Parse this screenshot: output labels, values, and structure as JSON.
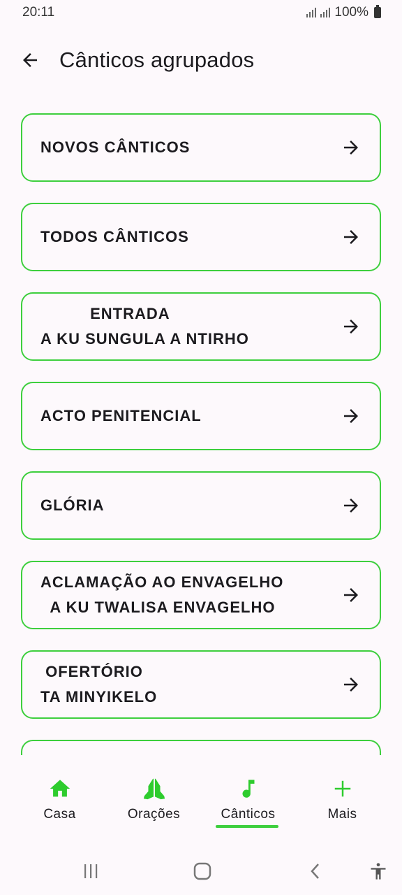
{
  "status_bar": {
    "time": "20:11",
    "battery": "100%"
  },
  "app_bar": {
    "title": "Cânticos agrupados"
  },
  "cards": [
    {
      "label": "NOVOS CÂNTICOS"
    },
    {
      "label": "TODOS CÂNTICOS"
    },
    {
      "label": "          ENTRADA\nA KU SUNGULA A NTIRHO"
    },
    {
      "label": "ACTO PENITENCIAL"
    },
    {
      "label": "GLÓRIA"
    },
    {
      "label": "ACLAMAÇÃO AO ENVAGELHO\n  A KU TWALISA ENVAGELHO"
    },
    {
      "label": " OFERTÓRIO\nTA MINYIKELO"
    }
  ],
  "bottom_nav": {
    "items": [
      {
        "label": "Casa",
        "icon": "home-icon"
      },
      {
        "label": "Orações",
        "icon": "praying-hands-icon"
      },
      {
        "label": "Cânticos",
        "icon": "music-note-icon",
        "active": true
      },
      {
        "label": "Mais",
        "icon": "plus-icon"
      }
    ]
  },
  "colors": {
    "accent": "#3ecf3e",
    "background": "#fdf9fc",
    "text": "#1c1b1f"
  }
}
